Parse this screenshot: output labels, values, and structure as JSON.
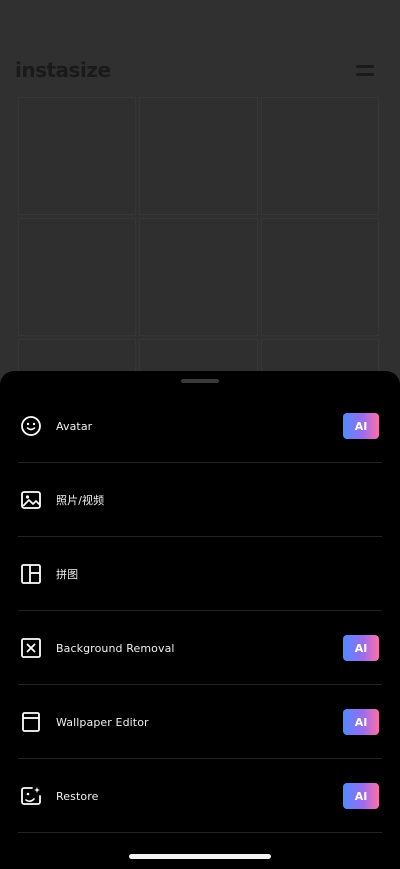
{
  "header": {
    "logo_text": "instasize",
    "menu_icon": "hamburger-menu-icon"
  },
  "sheet": {
    "items": [
      {
        "label": "Avatar",
        "icon": "smiley-face-icon",
        "badge": "AI"
      },
      {
        "label": "照片/视频",
        "icon": "image-icon",
        "badge": ""
      },
      {
        "label": "拼图",
        "icon": "collage-layout-icon",
        "badge": ""
      },
      {
        "label": "Background Removal",
        "icon": "remove-background-icon",
        "badge": "AI"
      },
      {
        "label": "Wallpaper Editor",
        "icon": "wallpaper-icon",
        "badge": "AI"
      },
      {
        "label": "Restore",
        "icon": "restore-photo-icon",
        "badge": "AI"
      }
    ]
  },
  "colors": {
    "background": "#303030",
    "sheet": "#000000",
    "badge_gradient_start": "#4f8bff",
    "badge_gradient_end": "#ff6fa8"
  }
}
